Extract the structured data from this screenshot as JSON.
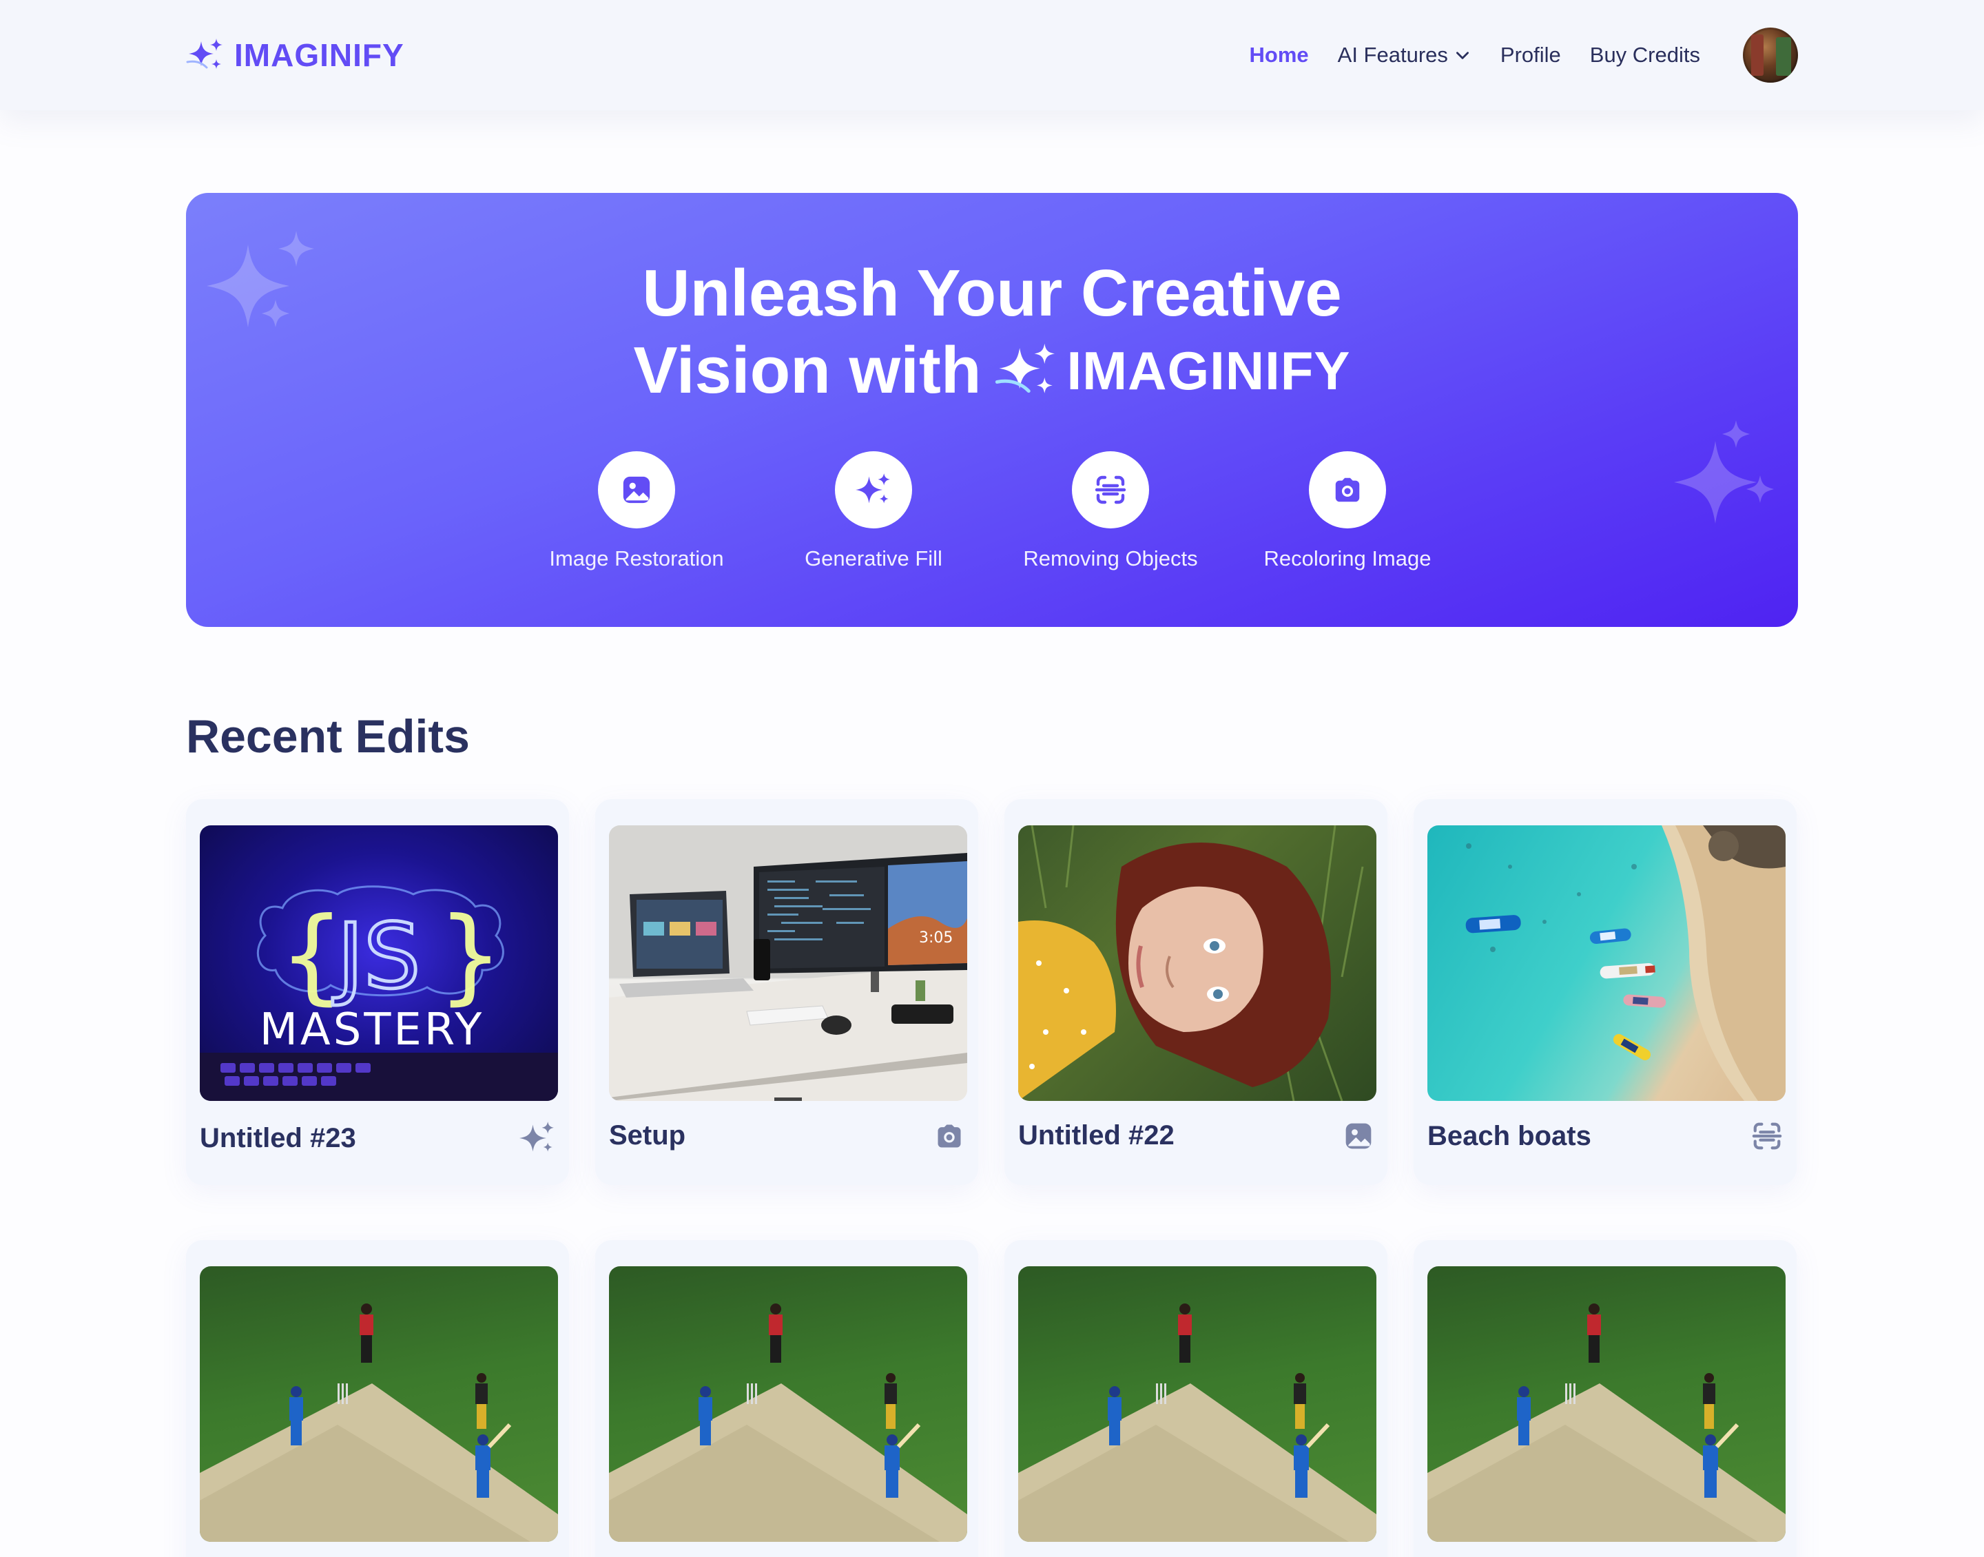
{
  "brand": {
    "name": "IMAGINIFY",
    "accent": "#624cf5"
  },
  "nav": {
    "home": "Home",
    "ai_features": "AI Features",
    "profile": "Profile",
    "buy_credits": "Buy Credits"
  },
  "hero": {
    "line1": "Unleash Your Creative",
    "line2": "Vision with",
    "brand": "IMAGINIFY",
    "features": [
      {
        "label": "Image Restoration",
        "icon": "image-icon"
      },
      {
        "label": "Generative Fill",
        "icon": "sparkles-icon"
      },
      {
        "label": "Removing Objects",
        "icon": "scan-icon"
      },
      {
        "label": "Recoloring Image",
        "icon": "camera-icon"
      }
    ]
  },
  "recent": {
    "title": "Recent Edits",
    "items": [
      {
        "title": "Untitled #23",
        "icon": "sparkles-icon"
      },
      {
        "title": "Setup",
        "icon": "camera-icon"
      },
      {
        "title": "Untitled #22",
        "icon": "image-icon"
      },
      {
        "title": "Beach boats",
        "icon": "scan-icon"
      }
    ]
  },
  "thumb_text": {
    "js": "JS",
    "mastery": "MASTERY",
    "clock": "3:05"
  }
}
